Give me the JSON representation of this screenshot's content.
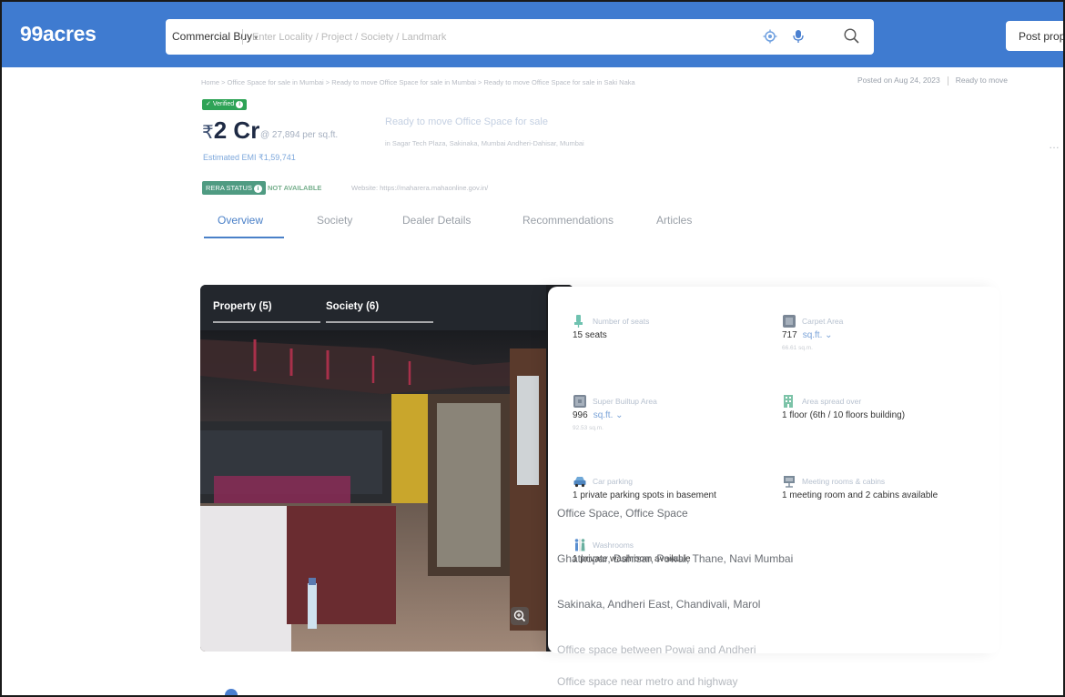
{
  "header": {
    "logo": "99acres",
    "search_type": "Commercial Buy",
    "search_placeholder": "Enter Locality / Project / Society / Landmark",
    "post_button": "Post property"
  },
  "breadcrumb": "Home > Office Space for sale in Mumbai > Ready to move Office Space for sale in Mumbai > Ready to move Office Space for sale in Saki Naka",
  "posted_date": "Posted on Aug 24, 2023",
  "posted_status": "Ready to move",
  "listing": {
    "verified_label": "Verified",
    "price": "2 Cr",
    "currency_symbol": "₹",
    "price_per_sqft": "@ 27,894 per sq.ft.",
    "emi": "Estimated EMI ₹1,59,741",
    "title": "Ready to move Office Space for sale",
    "location": "in Sagar Tech Plaza, Sakinaka, Mumbai Andheri-Dahisar, Mumbai",
    "rera_label": "RERA STATUS",
    "rera_status": "NOT AVAILABLE",
    "rera_website": "Website: https://maharera.mahaonline.gov.in/"
  },
  "tabs": [
    "Overview",
    "Society",
    "Dealer Details",
    "Recommendations",
    "Articles"
  ],
  "gallery": {
    "tab_property": "Property (5)",
    "tab_society": "Society (6)"
  },
  "features": [
    {
      "label": "Number of seats",
      "value": "15 seats",
      "unit": "",
      "sub": "",
      "icon": "seat-icon"
    },
    {
      "label": "Carpet Area",
      "value": "717",
      "unit": "sq.ft. ⌄",
      "sub": "66.61 sq.m.",
      "icon": "carpet-area-icon"
    },
    {
      "label": "Super Builtup Area",
      "value": "996",
      "unit": "sq.ft. ⌄",
      "sub": "92.53 sq.m.",
      "icon": "super-builtup-icon"
    },
    {
      "label": "Area spread over",
      "value": "1 floor (6th / 10 floors building)",
      "unit": "",
      "sub": "",
      "icon": "building-icon"
    },
    {
      "label": "Car parking",
      "value": "1 private parking spots in basement",
      "unit": "",
      "sub": "",
      "icon": "car-icon"
    },
    {
      "label": "Meeting rooms & cabins",
      "value": "1 meeting room and 2 cabins available",
      "unit": "",
      "sub": "",
      "icon": "meeting-room-icon"
    },
    {
      "label": "Washrooms",
      "value": "1 private washroom available",
      "unit": "",
      "sub": "",
      "icon": "washroom-icon"
    }
  ],
  "background_text": {
    "line1": "Office Space, Office Space",
    "line2": "Ghatkopar, Dahisar, Powai, Thane, Navi Mumbai",
    "line3": "Sakinaka, Andheri East, Chandivali, Marol",
    "line4": "Office space between Powai and Andheri",
    "line5": "Office space near metro and highway"
  },
  "colors": {
    "header_bg": "#3f7bd0",
    "accent": "#4a80c8",
    "verified": "#2ea356",
    "rera": "#4f9b82"
  }
}
